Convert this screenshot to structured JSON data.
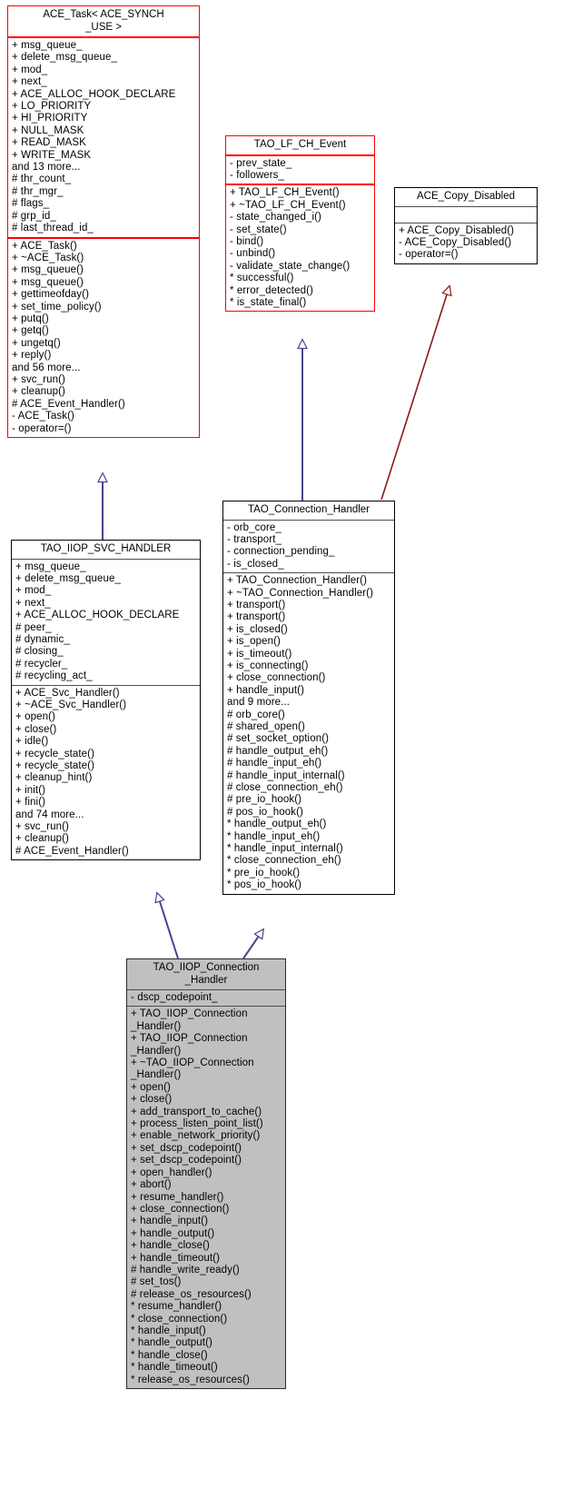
{
  "diagram": {
    "title": "TAO_IIOP_Connection_Handler inheritance diagram",
    "type": "uml-class-diagram",
    "colors": {
      "template_border": "#ff0000",
      "class_border": "#000000",
      "highlight_fill": "#c0c0c0",
      "inheritance_edge": "#46468c",
      "usage_edge": "#8b1a1a",
      "background": "#ffffff"
    }
  },
  "nodes": {
    "ace_task": {
      "name": "ACE_Task< ACE_SYNCH\n_USE >",
      "border": "red",
      "attributes": [
        "+ msg_queue_",
        "+ delete_msg_queue_",
        "+ mod_",
        "+ next_",
        "+ ACE_ALLOC_HOOK_DECLARE",
        "+ LO_PRIORITY",
        "+ HI_PRIORITY",
        "+ NULL_MASK",
        "+ READ_MASK",
        "+ WRITE_MASK",
        "and 13 more...",
        "# thr_count_",
        "# thr_mgr_",
        "# flags_",
        "# grp_id_",
        "# last_thread_id_"
      ],
      "operations": [
        "+ ACE_Task()",
        "+ ~ACE_Task()",
        "+ msg_queue()",
        "+ msg_queue()",
        "+ gettimeofday()",
        "+ set_time_policy()",
        "+ putq()",
        "+ getq()",
        "+ ungetq()",
        "+ reply()",
        "and 56 more...",
        "+ svc_run()",
        "+ cleanup()",
        "# ACE_Event_Handler()",
        "- ACE_Task()",
        "- operator=()"
      ]
    },
    "tao_lf_ch_event": {
      "name": "TAO_LF_CH_Event",
      "border": "red",
      "attributes": [
        "- prev_state_",
        "- followers_"
      ],
      "operations": [
        "+ TAO_LF_CH_Event()",
        "+ ~TAO_LF_CH_Event()",
        "- state_changed_i()",
        "- set_state()",
        "- bind()",
        "- unbind()",
        "- validate_state_change()",
        "* successful()",
        "* error_detected()",
        "* is_state_final()"
      ]
    },
    "ace_copy_disabled": {
      "name": "ACE_Copy_Disabled",
      "border": "black",
      "attributes": [],
      "operations": [
        "+ ACE_Copy_Disabled()",
        "- ACE_Copy_Disabled()",
        "- operator=()"
      ]
    },
    "tao_iiop_svc_handler": {
      "name": "TAO_IIOP_SVC_HANDLER",
      "border": "black",
      "attributes": [
        "+ msg_queue_",
        "+ delete_msg_queue_",
        "+ mod_",
        "+ next_",
        "+ ACE_ALLOC_HOOK_DECLARE",
        "# peer_",
        "# dynamic_",
        "# closing_",
        "# recycler_",
        "# recycling_act_"
      ],
      "operations": [
        "+ ACE_Svc_Handler()",
        "+ ~ACE_Svc_Handler()",
        "+ open()",
        "+ close()",
        "+ idle()",
        "+ recycle_state()",
        "+ recycle_state()",
        "+ cleanup_hint()",
        "+ init()",
        "+ fini()",
        "and 74 more...",
        "+ svc_run()",
        "+ cleanup()",
        "# ACE_Event_Handler()"
      ]
    },
    "tao_connection_handler": {
      "name": "TAO_Connection_Handler",
      "border": "black",
      "attributes": [
        "- orb_core_",
        "- transport_",
        "- connection_pending_",
        "- is_closed_"
      ],
      "operations": [
        "+ TAO_Connection_Handler()",
        "+ ~TAO_Connection_Handler()",
        "+ transport()",
        "+ transport()",
        "+ is_closed()",
        "+ is_open()",
        "+ is_timeout()",
        "+ is_connecting()",
        "+ close_connection()",
        "+ handle_input()",
        "and 9 more...",
        "# orb_core()",
        "# shared_open()",
        "# set_socket_option()",
        "# handle_output_eh()",
        "# handle_input_eh()",
        "# handle_input_internal()",
        "# close_connection_eh()",
        "# pre_io_hook()",
        "# pos_io_hook()",
        "* handle_output_eh()",
        "* handle_input_eh()",
        "* handle_input_internal()",
        "* close_connection_eh()",
        "* pre_io_hook()",
        "* pos_io_hook()"
      ]
    },
    "tao_iiop_connection_handler": {
      "name": "TAO_IIOP_Connection\n_Handler",
      "border": "gray",
      "attributes": [
        "- dscp_codepoint_"
      ],
      "operations": [
        "+ TAO_IIOP_Connection\n_Handler()",
        "+ TAO_IIOP_Connection\n_Handler()",
        "+ ~TAO_IIOP_Connection\n_Handler()",
        "+ open()",
        "+ close()",
        "+ add_transport_to_cache()",
        "+ process_listen_point_list()",
        "+ enable_network_priority()",
        "+ set_dscp_codepoint()",
        "+ set_dscp_codepoint()",
        "+ open_handler()",
        "+ abort()",
        "+ resume_handler()",
        "+ close_connection()",
        "+ handle_input()",
        "+ handle_output()",
        "+ handle_close()",
        "+ handle_timeout()",
        "# handle_write_ready()",
        "# set_tos()",
        "# release_os_resources()",
        "* resume_handler()",
        "* close_connection()",
        "* handle_input()",
        "* handle_output()",
        "* handle_close()",
        "* handle_timeout()",
        "* release_os_resources()"
      ]
    }
  },
  "edges": [
    {
      "from": "tao_iiop_svc_handler",
      "to": "ace_task",
      "kind": "inheritance"
    },
    {
      "from": "tao_connection_handler",
      "to": "tao_lf_ch_event",
      "kind": "inheritance"
    },
    {
      "from": "tao_connection_handler",
      "to": "ace_copy_disabled",
      "kind": "usage"
    },
    {
      "from": "tao_iiop_connection_handler",
      "to": "tao_iiop_svc_handler",
      "kind": "inheritance"
    },
    {
      "from": "tao_iiop_connection_handler",
      "to": "tao_connection_handler",
      "kind": "inheritance"
    }
  ]
}
